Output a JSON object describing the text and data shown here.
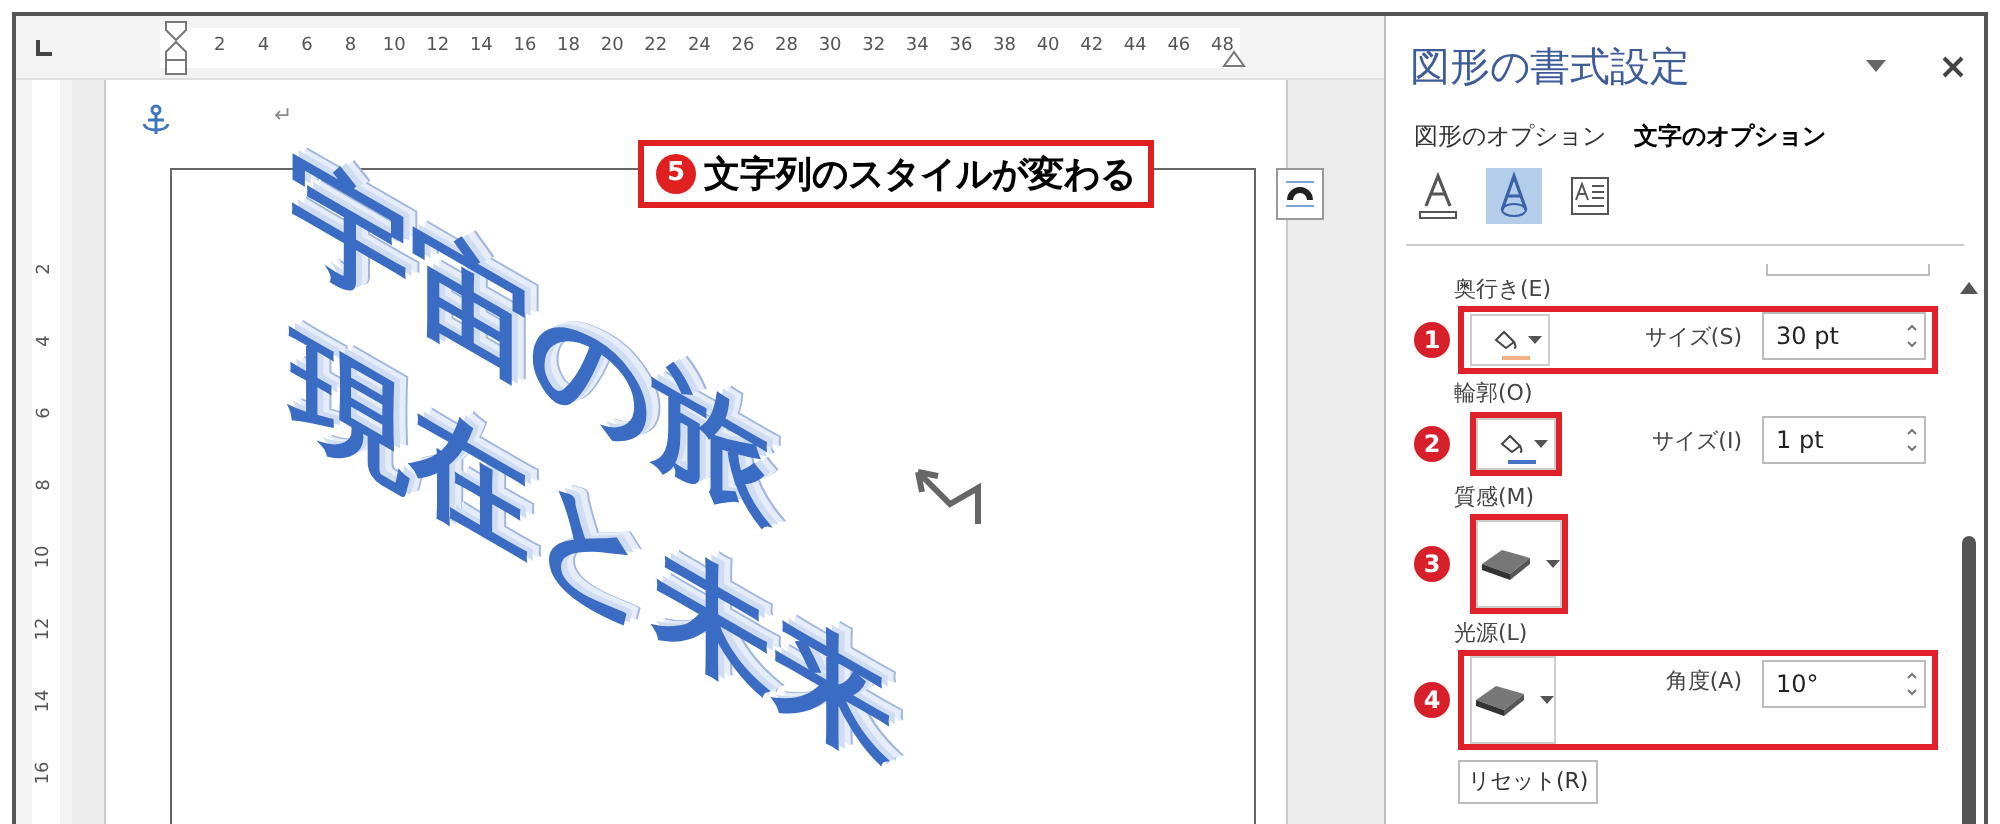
{
  "ruler": {
    "horizontal": [
      "2",
      "4",
      "6",
      "8",
      "10",
      "12",
      "14",
      "16",
      "18",
      "20",
      "22",
      "24",
      "26",
      "28",
      "30",
      "32",
      "34",
      "36",
      "38",
      "40",
      "42",
      "44",
      "46",
      "48"
    ],
    "vertical": [
      "2",
      "4",
      "6",
      "8",
      "10",
      "12",
      "14",
      "16"
    ]
  },
  "document": {
    "paragraph_mark": "↵",
    "word_art": [
      "宇宙の旅",
      "現在と未来"
    ],
    "callout": {
      "marker": "5",
      "text": "文字列のスタイルが変わる"
    }
  },
  "panel": {
    "title": "図形の書式設定",
    "tabs": [
      {
        "label": "図形のオプション",
        "selected": false
      },
      {
        "label": "文字のオプション",
        "selected": true
      }
    ],
    "icon_tabs": [
      {
        "kind": "fill_line",
        "selected": false
      },
      {
        "kind": "effects",
        "selected": true
      },
      {
        "kind": "textbox",
        "selected": false
      }
    ],
    "sections": [
      {
        "label": "奥行き(E)",
        "kind": "color",
        "color": "#f4b183",
        "field_label": "サイズ(S)",
        "value": "30 pt",
        "marker": "1",
        "highlight_row": true,
        "highlight_button": false
      },
      {
        "label": "輪郭(O)",
        "kind": "color",
        "color": "#4472c4",
        "field_label": "サイズ(I)",
        "value": "1 pt",
        "marker": "2",
        "highlight_row": false,
        "highlight_button": true
      },
      {
        "label": "質感(M)",
        "kind": "material",
        "marker": "3",
        "highlight_row": false,
        "highlight_button": true
      },
      {
        "label": "光源(L)",
        "kind": "material",
        "field_label": "角度(A)",
        "value": "10°",
        "marker": "4",
        "highlight_row": true,
        "highlight_button": false
      }
    ],
    "reset": "リセット(R)"
  }
}
